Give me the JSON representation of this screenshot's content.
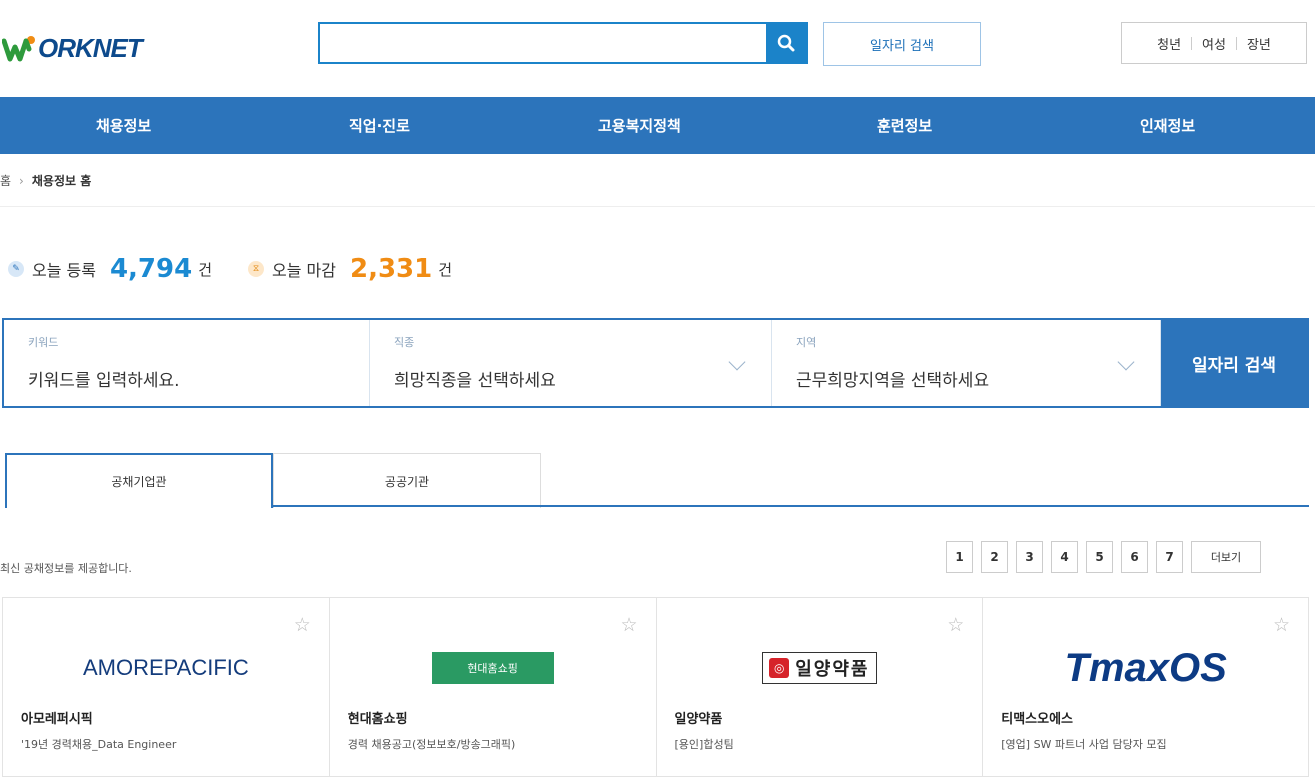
{
  "header": {
    "logo_text": "ORKNET",
    "search_placeholder": "",
    "job_search_link": "일자리 검색",
    "groups": [
      "청년",
      "여성",
      "장년"
    ]
  },
  "nav": {
    "items": [
      "채용정보",
      "직업·진로",
      "고용복지정책",
      "훈련정보",
      "인재정보"
    ]
  },
  "breadcrumb": {
    "home": "홈",
    "current": "채용정보 홈"
  },
  "stats": {
    "registered_label": "오늘 등록",
    "registered_value": "4,794",
    "registered_unit": "건",
    "closing_label": "오늘 마감",
    "closing_value": "2,331",
    "closing_unit": "건"
  },
  "search_form": {
    "keyword_label": "키워드",
    "keyword_placeholder": "키워드를 입력하세요.",
    "job_label": "직종",
    "job_value": "희망직종을 선택하세요",
    "region_label": "지역",
    "region_value": "근무희망지역을 선택하세요",
    "submit_label": "일자리 검색"
  },
  "tabs": [
    {
      "label": "공채기업관",
      "active": true
    },
    {
      "label": "공공기관",
      "active": false
    }
  ],
  "list": {
    "description": "최신 공채정보를 제공합니다.",
    "pages": [
      "1",
      "2",
      "3",
      "4",
      "5",
      "6",
      "7"
    ],
    "more_label": "더보기"
  },
  "cards": [
    {
      "logo": "AMOREPACIFIC",
      "company": "아모레퍼시픽",
      "title": "'19년 경력채용_Data Engineer"
    },
    {
      "logo": "현대홈쇼핑",
      "company": "현대홈쇼핑",
      "title": "경력 채용공고(정보보호/방송그래픽)"
    },
    {
      "logo": "일양약품",
      "company": "일양약품",
      "title": "[용인]합성팀"
    },
    {
      "logo": "TmaxOS",
      "company": "티맥스오에스",
      "title": "[영업] SW 파트너 사업 담당자 모집"
    }
  ],
  "colors": {
    "brand_blue": "#2c74bb",
    "accent_blue": "#1b8ad2",
    "accent_orange": "#f08c14"
  }
}
